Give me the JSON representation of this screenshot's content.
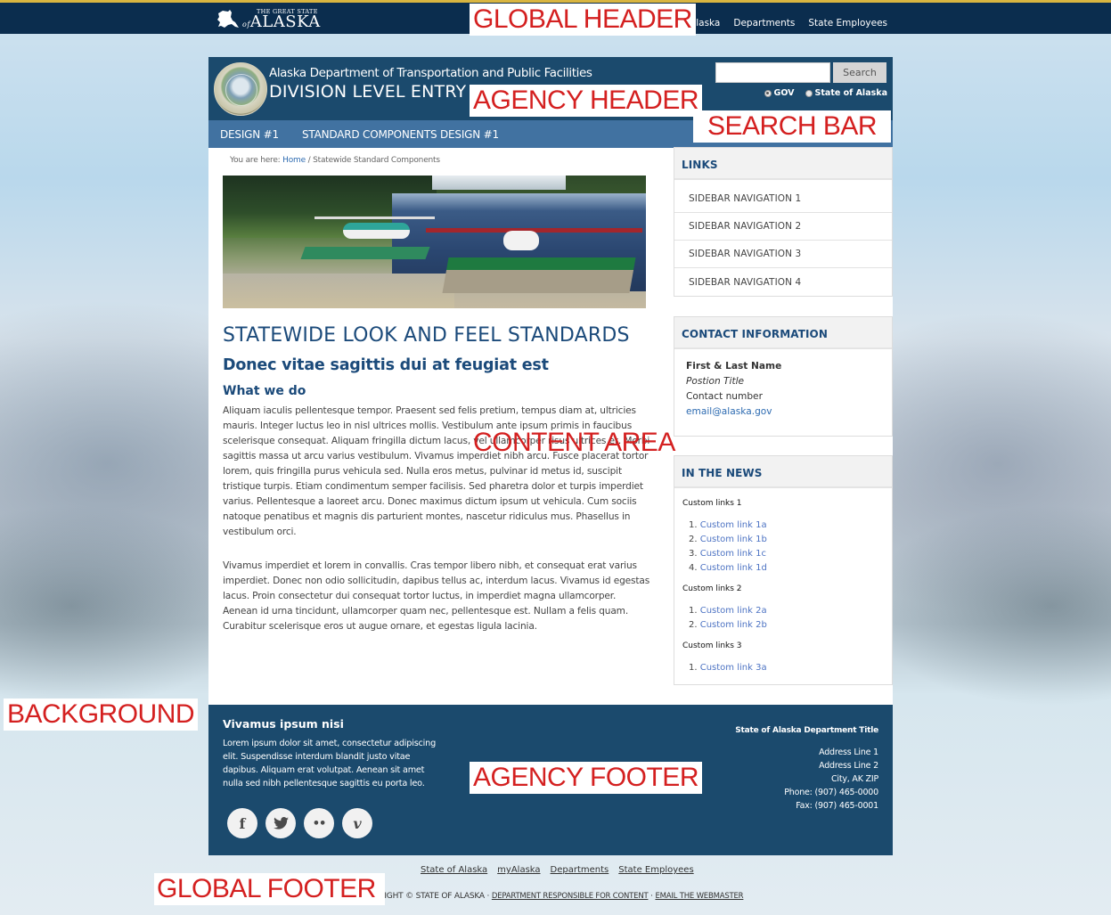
{
  "global_header": {
    "logo_small": "THE GREAT STATE",
    "logo_of": "of",
    "logo_big": "ALASKA",
    "nav": [
      "myAlaska",
      "Departments",
      "State Employees"
    ]
  },
  "agency_header": {
    "department": "Alaska Department of Transportation and Public Facilities",
    "division": "DIVISION LEVEL ENTRY",
    "search": {
      "value": "",
      "placeholder": "",
      "button_label": "Search",
      "options": [
        {
          "label": "GOV",
          "checked": true
        },
        {
          "label": "State of Alaska",
          "checked": false
        }
      ]
    }
  },
  "agency_nav": [
    "DESIGN #1",
    "STANDARD COMPONENTS DESIGN #1"
  ],
  "breadcrumb": {
    "prefix": "You are here: ",
    "home": "Home",
    "separator": " / ",
    "current": "Statewide Standard Components"
  },
  "content": {
    "title": "STATEWIDE LOOK AND FEEL STANDARDS",
    "subtitle": "Donec vitae sagittis dui at feugiat est",
    "section_heading": "What we do",
    "paragraphs": [
      "Aliquam iaculis pellentesque tempor. Praesent sed felis pretium, tempus diam at, ultricies mauris. Integer luctus leo in nisl ultrices mollis. Vestibulum ante ipsum primis in faucibus scelerisque consequat. Aliquam fringilla dictum lacus, vel ullamcorper risus ultrices et. Morbi sagittis massa ut arcu varius vestibulum. Vivamus imperdiet nibh arcu. Fusce placerat tortor lorem, quis fringilla purus vehicula sed. Nulla eros metus, pulvinar id metus id, suscipit tristique turpis. Etiam condimentum semper facilisis. Sed pharetra dolor et turpis imperdiet varius. Pellentesque a laoreet arcu. Donec maximus dictum ipsum ut vehicula. Cum sociis natoque penatibus et magnis dis parturient montes, nascetur ridiculus mus. Phasellus in vestibulum orci.",
      "Vivamus imperdiet et lorem in convallis. Cras tempor libero nibh, et consequat erat varius imperdiet. Donec non odio sollicitudin, dapibus tellus ac, interdum lacus. Vivamus id egestas lacus. Proin consectetur dui consequat tortor luctus, in imperdiet magna ullamcorper. Aenean id urna tincidunt, ullamcorper quam nec, pellentesque est. Nullam a felis quam. Curabitur scelerisque eros ut augue ornare, et egestas ligula lacinia."
    ]
  },
  "sidebar": {
    "links": {
      "title": "LINKS",
      "items": [
        "SIDEBAR NAVIGATION 1",
        "SIDEBAR NAVIGATION 2",
        "SIDEBAR NAVIGATION 3",
        "SIDEBAR NAVIGATION 4"
      ]
    },
    "contact": {
      "title": "CONTACT INFORMATION",
      "name": "First & Last Name",
      "position": "Postion Title",
      "number": "Contact number",
      "email": "email@alaska.gov"
    },
    "news": {
      "title": "IN THE NEWS",
      "groups": [
        {
          "title": "Custom links 1",
          "links": [
            "Custom link 1a",
            "Custom link 1b",
            "Custom link 1c",
            "Custom link 1d"
          ]
        },
        {
          "title": "Custom links 2",
          "links": [
            "Custom link 2a",
            "Custom link 2b"
          ]
        },
        {
          "title": "Custom links 3",
          "links": [
            "Custom link 3a"
          ]
        }
      ]
    }
  },
  "agency_footer": {
    "title": "Vivamus ipsum nisi",
    "text": "Lorem ipsum dolor sit amet, consectetur adipiscing elit. Suspendisse interdum blandit justo vitae dapibus. Aliquam erat volutpat. Aenean sit amet nulla sed nibh pellentesque sagittis eu porta leo.",
    "social": [
      {
        "icon": "facebook-icon",
        "glyph": "f"
      },
      {
        "icon": "twitter-icon",
        "glyph": "🐦"
      },
      {
        "icon": "flickr-icon",
        "glyph": "••"
      },
      {
        "icon": "vimeo-icon",
        "glyph": "v"
      }
    ],
    "department_title": "State of Alaska Department Title",
    "address": [
      "Address Line 1",
      "Address Line 2",
      "City, AK ZIP",
      "Phone: (907) 465-0000",
      "Fax: (907) 465-0001"
    ]
  },
  "global_footer": {
    "links": [
      "State of Alaska",
      "myAlaska",
      "Departments",
      "State Employees"
    ],
    "copyright": "COPYRIGHT © STATE OF ALASKA · ",
    "dept_link": "DEPARTMENT RESPONSIBLE FOR CONTENT",
    "separator": " · ",
    "webmaster_link": "EMAIL THE WEBMASTER"
  },
  "annotations": {
    "global_header": "GLOBAL HEADER",
    "agency_header": "AGENCY HEADER",
    "search_bar": "SEARCH BAR",
    "content_area": "CONTENT AREA",
    "background": "BACKGROUND",
    "agency_footer": "AGENCY FOOTER",
    "global_footer": "GLOBAL FOOTER"
  },
  "colors": {
    "global_header_bg": "#0b2d4e",
    "global_header_accent": "#d9b540",
    "agency_header_bg": "#1b4a6d",
    "agency_nav_bg": "#4172a1",
    "heading_text": "#1b4a7a",
    "link": "#2d6bb1",
    "annotation_text": "#d42020"
  }
}
